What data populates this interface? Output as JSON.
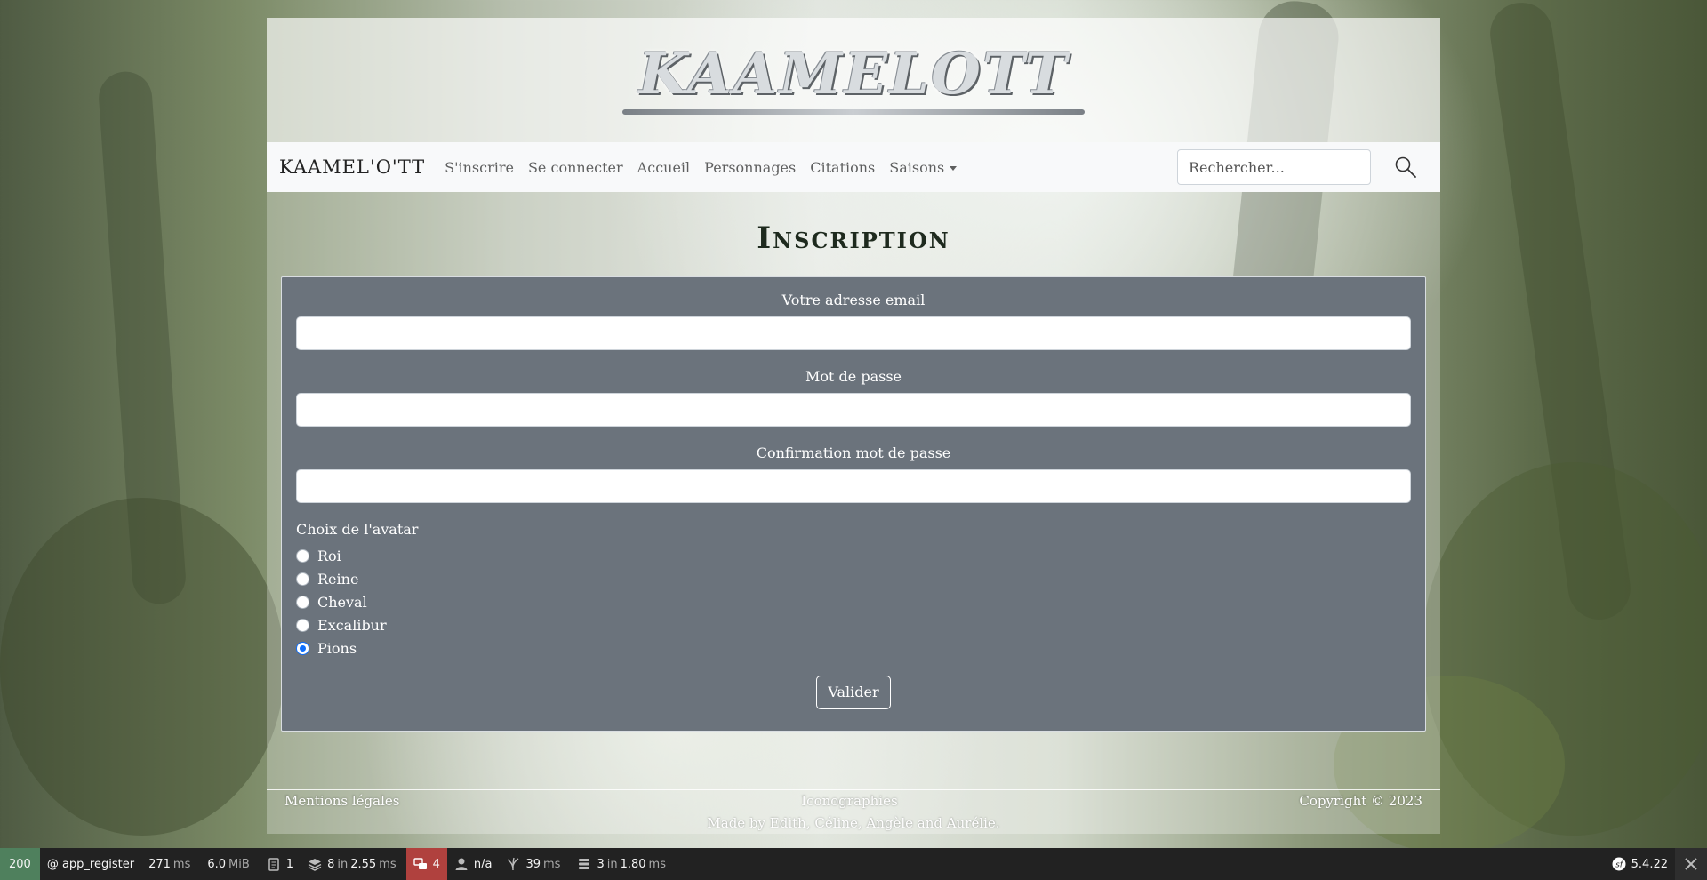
{
  "header": {
    "logo_text": "KAAMELOTT"
  },
  "navbar": {
    "brand": "KAAMEL'O'TT",
    "links": [
      {
        "label": "S'inscrire"
      },
      {
        "label": "Se connecter"
      },
      {
        "label": "Accueil"
      },
      {
        "label": "Personnages"
      },
      {
        "label": "Citations"
      },
      {
        "label": "Saisons"
      }
    ],
    "search": {
      "placeholder": "Rechercher...",
      "value": ""
    }
  },
  "page": {
    "title": "Inscription"
  },
  "form": {
    "email_label": "Votre adresse email",
    "password_label": "Mot de passe",
    "confirm_label": "Confirmation mot de passe",
    "avatar_label": "Choix de l'avatar",
    "avatar_options": [
      {
        "label": "Roi",
        "checked": false
      },
      {
        "label": "Reine",
        "checked": false
      },
      {
        "label": "Cheval",
        "checked": false
      },
      {
        "label": "Excalibur",
        "checked": false
      },
      {
        "label": "Pions",
        "checked": true
      }
    ],
    "submit_label": "Valider"
  },
  "footer": {
    "legal": "Mentions légales",
    "icons": "Iconographies",
    "copyright": "Copyright © 2023",
    "credits": "Made by Edith, Céline, Angèle and Aurélie."
  },
  "debug_toolbar": {
    "status": "200",
    "route": "@ app_register",
    "time_value": "271",
    "time_unit": "ms",
    "memory_value": "6.0",
    "memory_unit": "MiB",
    "logs": "1",
    "cache_value": "8",
    "cache_in": "in",
    "cache_time": "2.55",
    "cache_unit": "ms",
    "translation": "4",
    "user": "n/a",
    "twig_value": "39",
    "twig_unit": "ms",
    "db_value": "3",
    "db_in": "in",
    "db_time": "1.80",
    "db_unit": "ms",
    "symfony_version": "5.4.22"
  },
  "colors": {
    "form_bg": "#6b737c",
    "navbar_bg": "#f8f9fa",
    "toolbar_bg": "#222222",
    "status_green": "#4f805d",
    "alert_red": "#b0413e",
    "radio_checked": "#0d6efd"
  }
}
